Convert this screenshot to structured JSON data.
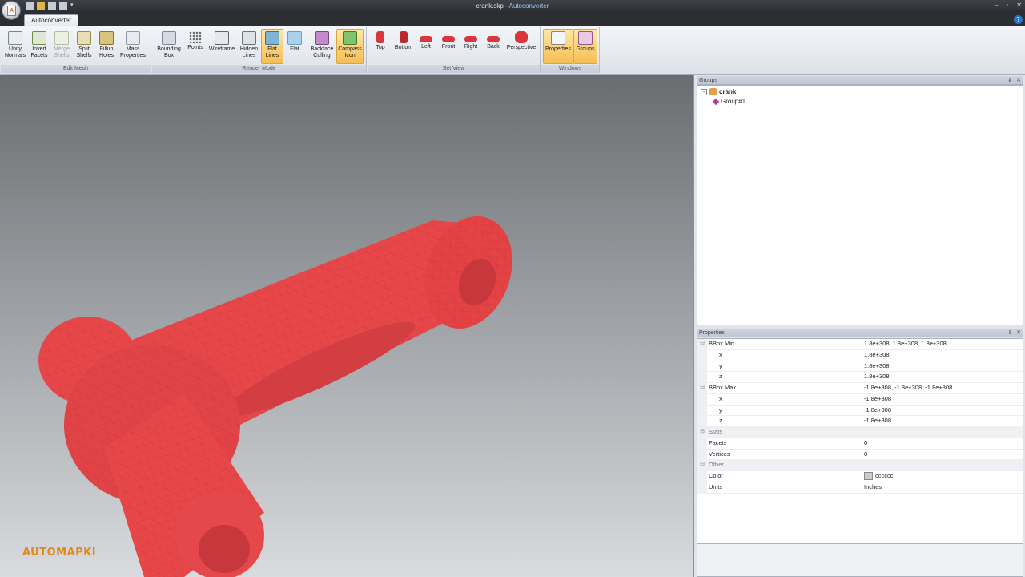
{
  "window": {
    "file": "crank.skp",
    "separator": " - ",
    "app": "Autoconverter",
    "controls": [
      "–",
      "▫",
      "✕"
    ]
  },
  "ribbon": {
    "tab": "Autoconverter",
    "help": "?",
    "groups": {
      "edit_mesh": "Edit Mesh",
      "render_mode": "Render Mode",
      "set_view": "Set View",
      "windows": "Windows"
    },
    "buttons": {
      "unify_normals": "Unify\nNormals",
      "invert_facets": "Invert\nFacets",
      "merge_shells": "Merge\nShells",
      "split_shells": "Split\nShells",
      "fillup_holes": "Fillup\nHoles",
      "mass_properties": "Mass\nProperties",
      "bounding_box": "Bounding\nBox",
      "points": "Points",
      "wireframe": "Wireframe",
      "hidden_lines": "Hidden\nLines",
      "flat_lines": "Flat\nLines",
      "flat": "Flat",
      "backface_culling": "Backface\nCulling",
      "compass_icon": "Compass\nIcon",
      "top": "Top",
      "bottom": "Bottom",
      "left": "Left",
      "front": "Front",
      "right": "Right",
      "back": "Back",
      "perspective": "Perspective",
      "properties": "Properties",
      "groups": "Groups"
    }
  },
  "viewport": {
    "watermark": "AUTOMAPKI",
    "model_color": "#e8474a"
  },
  "groups_panel": {
    "title": "Groups",
    "root": "crank",
    "child": "Group#1"
  },
  "properties_panel": {
    "title": "Properties",
    "rows": [
      {
        "type": "cat",
        "key": "BBox Min",
        "value": "1.8e+308, 1.8e+308, 1.8e+308"
      },
      {
        "type": "sub",
        "key": "x",
        "value": "1.8e+308"
      },
      {
        "type": "sub",
        "key": "y",
        "value": "1.8e+308"
      },
      {
        "type": "sub",
        "key": "z",
        "value": "1.8e+308"
      },
      {
        "type": "cat",
        "key": "BBox Max",
        "value": "-1.8e+308, -1.8e+308, -1.8e+308"
      },
      {
        "type": "sub",
        "key": "x",
        "value": "-1.8e+308"
      },
      {
        "type": "sub",
        "key": "y",
        "value": "-1.8e+308"
      },
      {
        "type": "sub",
        "key": "z",
        "value": "-1.8e+308"
      },
      {
        "type": "section",
        "key": "Stats",
        "value": ""
      },
      {
        "type": "item",
        "key": "Facets",
        "value": "0"
      },
      {
        "type": "item",
        "key": "Vertices",
        "value": "0"
      },
      {
        "type": "section",
        "key": "Other",
        "value": ""
      },
      {
        "type": "color",
        "key": "Color",
        "value": "cccccc"
      },
      {
        "type": "item",
        "key": "Units",
        "value": "Inches"
      }
    ]
  }
}
